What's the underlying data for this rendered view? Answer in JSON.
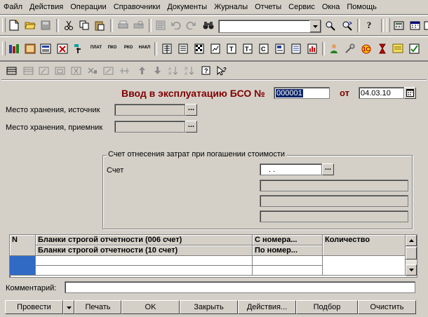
{
  "menu": [
    "Файл",
    "Действия",
    "Операции",
    "Справочники",
    "Документы",
    "Журналы",
    "Отчеты",
    "Сервис",
    "Окна",
    "Помощь"
  ],
  "toolbar2": {
    "plat": "ПЛАТ",
    "pko": "ПКО",
    "rko": "РКО",
    "nakl": "НАКЛ"
  },
  "doc": {
    "title": "Ввод в эксплуатацию БСО №",
    "number": "000001",
    "date_label": "от",
    "date": "04.03.10"
  },
  "form": {
    "storage_source_label": "Место хранения, источник",
    "storage_receiver_label": "Место хранения, приемник",
    "group_title": "Счет отнесения затрат при погашении стоимости",
    "account_label": "Счет",
    "account_value": ". ."
  },
  "table": {
    "col_n": "N",
    "col_blanks_1": "Бланки строгой отчетности (006 счет)",
    "col_blanks_2": "Бланки строгой отчетности (10 счет)",
    "col_from": "С номера...",
    "col_to": "По номер...",
    "col_qty": "Количество"
  },
  "comment_label": "Комментарий:",
  "buttons": {
    "post": "Провести",
    "print": "Печать",
    "ok": "OK",
    "close": "Закрыть",
    "actions": "Действия...",
    "selection": "Подбор",
    "clear": "Очистить"
  },
  "colors": {
    "title": "#800000",
    "selection": "#0a246a",
    "window_bg": "#d4d0c8",
    "row_marker": "#316ac5"
  }
}
